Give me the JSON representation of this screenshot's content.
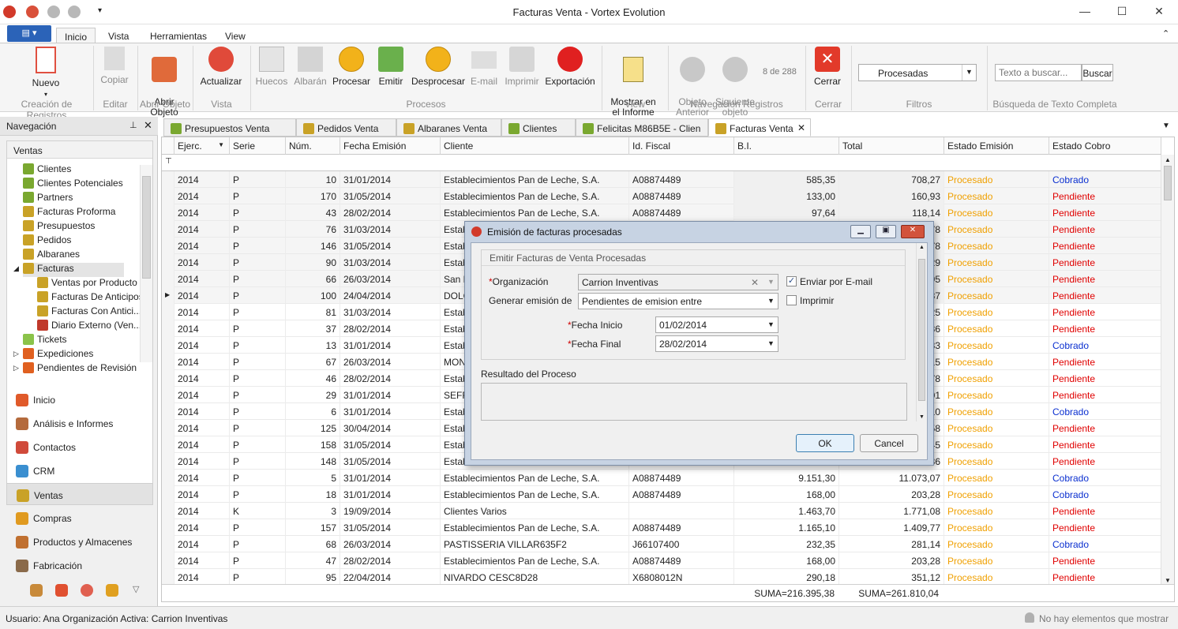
{
  "window": {
    "title": "Facturas Venta - Vortex Evolution"
  },
  "ribbon_tabs": [
    {
      "label": "Inicio",
      "active": true
    },
    {
      "label": "Vista"
    },
    {
      "label": "Herramientas"
    },
    {
      "label": "View"
    }
  ],
  "ribbon": {
    "nuevo": "Nuevo",
    "copiar": "Copiar",
    "abrir": "Abrir\nObjeto",
    "actualizar": "Actualizar",
    "huecos": "Huecos",
    "albaran": "Albarán",
    "procesar": "Procesar",
    "emitir": "Emitir",
    "desprocesar": "Desprocesar",
    "email": "E-mail",
    "imprimir": "Imprimir",
    "exportacion": "Exportación",
    "mostrar": "Mostrar en\nel Informe",
    "anterior": "Objeto\nAnterior",
    "siguiente": "Siguiente\nobjeto",
    "counter": "8 de 288",
    "cerrar": "Cerrar",
    "filter_value": "Procesadas",
    "search_placeholder": "Texto a buscar...",
    "search_button": "Buscar",
    "groups": {
      "creacion": "Creación de Registros",
      "editar": "Editar",
      "abrir": "Abrir Objeto",
      "vista": "Vista",
      "procesos": "Procesos",
      "view": "View",
      "navegacion": "Navegación Registros",
      "cerrar": "Cerrar",
      "filtros": "Filtros",
      "busqueda": "Búsqueda de Texto Completa"
    }
  },
  "nav": {
    "title": "Navegación",
    "group": "Ventas",
    "tree": [
      {
        "label": "Clientes",
        "color": "#7aa830"
      },
      {
        "label": "Clientes Potenciales",
        "color": "#7aa830"
      },
      {
        "label": "Partners",
        "color": "#7aa830"
      },
      {
        "label": "Facturas Proforma",
        "color": "#c9a227"
      },
      {
        "label": "Presupuestos",
        "color": "#c9a227"
      },
      {
        "label": "Pedidos",
        "color": "#c9a227"
      },
      {
        "label": "Albaranes",
        "color": "#c9a227"
      },
      {
        "label": "Facturas",
        "color": "#c9a227"
      },
      {
        "label": "Ventas por Producto",
        "color": "#c9a227"
      },
      {
        "label": "Facturas De Anticipos",
        "color": "#c9a227"
      },
      {
        "label": "Facturas Con Antici...",
        "color": "#c9a227"
      },
      {
        "label": "Diario Externo (Ven...",
        "color": "#c0392b"
      },
      {
        "label": "Tickets",
        "color": "#8bc34a"
      },
      {
        "label": "Expediciones",
        "color": "#e06020"
      },
      {
        "label": "Pendientes de Revisión",
        "color": "#e06020"
      }
    ],
    "modules": [
      {
        "label": "Inicio",
        "color": "#e05a2a"
      },
      {
        "label": "Análisis e Informes",
        "color": "#b46a3c"
      },
      {
        "label": "Contactos",
        "color": "#d04a3a"
      },
      {
        "label": "CRM",
        "color": "#3a8fd0"
      },
      {
        "label": "Ventas",
        "color": "#c9a227"
      },
      {
        "label": "Compras",
        "color": "#e09a20"
      },
      {
        "label": "Productos y Almacenes",
        "color": "#c07030"
      },
      {
        "label": "Fabricación",
        "color": "#8a6a4a"
      }
    ]
  },
  "doc_tabs": [
    "Presupuestos Venta",
    "Pedidos Venta",
    "Albaranes Venta",
    "Clientes",
    "Felicitas M86B5E - Clien",
    "Facturas Venta"
  ],
  "grid": {
    "columns": [
      "Ejerc.",
      "Serie",
      "Núm.",
      "Fecha Emisión",
      "Cliente",
      "Id. Fiscal",
      "B.I.",
      "Total",
      "Estado Emisión",
      "Estado Cobro"
    ],
    "rows": [
      [
        "2014",
        "P",
        "10",
        "31/01/2014",
        "Establecimientos Pan de Leche, S.A.",
        "A08874489",
        "585,35",
        "708,27",
        "Procesado",
        "Cobrado"
      ],
      [
        "2014",
        "P",
        "170",
        "31/05/2014",
        "Establecimientos Pan de Leche, S.A.",
        "A08874489",
        "133,00",
        "160,93",
        "Procesado",
        "Pendiente"
      ],
      [
        "2014",
        "P",
        "43",
        "28/02/2014",
        "Establecimientos Pan de Leche, S.A.",
        "A08874489",
        "97,64",
        "118,14",
        "Procesado",
        "Pendiente"
      ],
      [
        "2014",
        "P",
        "76",
        "31/03/2014",
        "Estab",
        "",
        "",
        "78",
        "Procesado",
        "Pendiente"
      ],
      [
        "2014",
        "P",
        "146",
        "31/05/2014",
        "Estab",
        "",
        "",
        "78",
        "Procesado",
        "Pendiente"
      ],
      [
        "2014",
        "P",
        "90",
        "31/03/2014",
        "Estab",
        "",
        "",
        "29",
        "Procesado",
        "Pendiente"
      ],
      [
        "2014",
        "P",
        "66",
        "26/03/2014",
        "San M",
        "",
        "",
        "95",
        "Procesado",
        "Pendiente"
      ],
      [
        "2014",
        "P",
        "100",
        "24/04/2014",
        "DOLÇ",
        "",
        "",
        "37",
        "Procesado",
        "Pendiente"
      ],
      [
        "2014",
        "P",
        "81",
        "31/03/2014",
        "Estab",
        "",
        "",
        "25",
        "Procesado",
        "Pendiente"
      ],
      [
        "2014",
        "P",
        "37",
        "28/02/2014",
        "Estab",
        "",
        "",
        "36",
        "Procesado",
        "Pendiente"
      ],
      [
        "2014",
        "P",
        "13",
        "31/01/2014",
        "Estab",
        "",
        "",
        "33",
        "Procesado",
        "Cobrado"
      ],
      [
        "2014",
        "P",
        "67",
        "26/03/2014",
        "MONI",
        "",
        "",
        "15",
        "Procesado",
        "Pendiente"
      ],
      [
        "2014",
        "P",
        "46",
        "28/02/2014",
        "Estab",
        "",
        "",
        "78",
        "Procesado",
        "Pendiente"
      ],
      [
        "2014",
        "P",
        "29",
        "31/01/2014",
        "SEFRI",
        "",
        "",
        "01",
        "Procesado",
        "Pendiente"
      ],
      [
        "2014",
        "P",
        "6",
        "31/01/2014",
        "Estab",
        "",
        "",
        "10",
        "Procesado",
        "Cobrado"
      ],
      [
        "2014",
        "P",
        "125",
        "30/04/2014",
        "Estab",
        "",
        "",
        "58",
        "Procesado",
        "Pendiente"
      ],
      [
        "2014",
        "P",
        "158",
        "31/05/2014",
        "Estab",
        "",
        "",
        "45",
        "Procesado",
        "Pendiente"
      ],
      [
        "2014",
        "P",
        "148",
        "31/05/2014",
        "Estab",
        "",
        "",
        "36",
        "Procesado",
        "Pendiente"
      ],
      [
        "2014",
        "P",
        "5",
        "31/01/2014",
        "Establecimientos Pan de Leche, S.A.",
        "A08874489",
        "9.151,30",
        "11.073,07",
        "Procesado",
        "Cobrado"
      ],
      [
        "2014",
        "P",
        "18",
        "31/01/2014",
        "Establecimientos Pan de Leche, S.A.",
        "A08874489",
        "168,00",
        "203,28",
        "Procesado",
        "Cobrado"
      ],
      [
        "2014",
        "K",
        "3",
        "19/09/2014",
        "Clientes Varios",
        "",
        "1.463,70",
        "1.771,08",
        "Procesado",
        "Pendiente"
      ],
      [
        "2014",
        "P",
        "157",
        "31/05/2014",
        "Establecimientos Pan de Leche, S.A.",
        "A08874489",
        "1.165,10",
        "1.409,77",
        "Procesado",
        "Pendiente"
      ],
      [
        "2014",
        "P",
        "68",
        "26/03/2014",
        "PASTISSERIA VILLAR635F2",
        "J66107400",
        "232,35",
        "281,14",
        "Procesado",
        "Cobrado"
      ],
      [
        "2014",
        "P",
        "47",
        "28/02/2014",
        "Establecimientos Pan de Leche, S.A.",
        "A08874489",
        "168,00",
        "203,28",
        "Procesado",
        "Pendiente"
      ],
      [
        "2014",
        "P",
        "95",
        "22/04/2014",
        "NIVARDO CESC8D28",
        "X6808012N",
        "290,18",
        "351,12",
        "Procesado",
        "Pendiente"
      ]
    ],
    "sum_bi": "SUMA=216.395,38",
    "sum_total": "SUMA=261.810,04"
  },
  "dialog": {
    "title": "Emisión de facturas procesadas",
    "section": "Emitir Facturas de Venta Procesadas",
    "org_label": "Organización",
    "org_value": "Carrion Inventivas",
    "email_label": "Enviar por E-mail",
    "email_checked": true,
    "print_label": "Imprimir",
    "print_checked": false,
    "gen_label": "Generar emisión de",
    "gen_value": "Pendientes de emision entre",
    "fini_label": "Fecha Inicio",
    "fini_value": "01/02/2014",
    "ffin_label": "Fecha Final",
    "ffin_value": "28/02/2014",
    "result_label": "Resultado del Proceso",
    "ok": "OK",
    "cancel": "Cancel"
  },
  "status": {
    "user": "Usuario: Ana",
    "org": "Organización Activa: Carrion Inventivas",
    "notif": "No hay elementos que mostrar"
  }
}
